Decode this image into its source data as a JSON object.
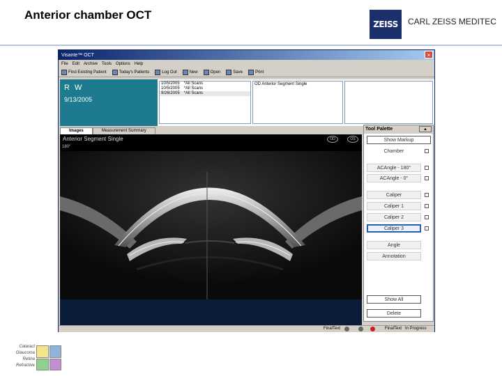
{
  "slide": {
    "title": "Anterior chamber OCT",
    "brand": "CARL ZEISS MEDITEC",
    "logo_text": "ZEISS",
    "categories": [
      "Cataract",
      "Glaucoma",
      "Retina",
      "Refractive"
    ]
  },
  "app": {
    "window_title": "Visante™ OCT",
    "menu": [
      "File",
      "Edit",
      "Archive",
      "Tools",
      "Options",
      "Help"
    ],
    "toolbar": [
      "Find Existing Patient",
      "Today's Patients",
      "Log Out",
      "New",
      "Open",
      "Save",
      "Print"
    ],
    "patient": {
      "name": "R W",
      "date": "9/13/2005"
    },
    "visits": [
      {
        "date": "10/5/2005",
        "scan": "*All Scans"
      },
      {
        "date": "10/5/2005",
        "scan": "*All Scans"
      },
      {
        "date": "9/26/2005",
        "scan": "*All Scans"
      }
    ],
    "scan_label": "OD Anterior Segment Single",
    "tabs": [
      "Images",
      "Measurement Summary"
    ],
    "viewer": {
      "title": "Anterior Segment Single",
      "eye_od": "OD",
      "eye_os": "OS",
      "angle_label": "180°"
    },
    "palette": {
      "title": "Tool Palette",
      "show_markup": "Show Markup",
      "chamber": "Chamber",
      "acangle_180": "ACAngle - 180°",
      "acangle_0": "ACAngle - 0°",
      "caliper": "Caliper",
      "caliper1": "Caliper 1",
      "caliper2": "Caliper 2",
      "caliper3": "Caliper 3",
      "angle": "Angle",
      "annotation": "Annotation",
      "show_all": "Show All",
      "delete": "Delete"
    },
    "status": {
      "left": "FinalText",
      "right": "FinalText",
      "state": "In Progress"
    }
  }
}
